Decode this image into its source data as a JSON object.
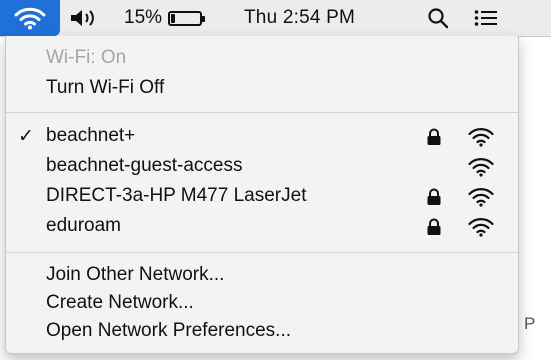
{
  "menubar": {
    "wifi_icon": "wifi-icon",
    "volume_icon": "speaker-volume-icon",
    "battery_percent": "15%",
    "battery_level": 0.15,
    "clock": "Thu 2:54 PM",
    "search_icon": "spotlight-search-icon",
    "list_icon": "notification-center-icon",
    "accent_color": "#1f70d8"
  },
  "wifi_menu": {
    "status": "Wi-Fi: On",
    "toggle": "Turn Wi-Fi Off",
    "networks": [
      {
        "name": "beachnet+",
        "connected": true,
        "locked": true,
        "signal": "full"
      },
      {
        "name": "beachnet-guest-access",
        "connected": false,
        "locked": false,
        "signal": "full"
      },
      {
        "name": "DIRECT-3a-HP M477 LaserJet",
        "connected": false,
        "locked": true,
        "signal": "full"
      },
      {
        "name": "eduroam",
        "connected": false,
        "locked": true,
        "signal": "full"
      }
    ],
    "check_mark": "✓",
    "join_other": "Join Other Network...",
    "create_network": "Create Network...",
    "open_prefs": "Open Network Preferences..."
  },
  "background": {
    "edge_text": "P"
  }
}
